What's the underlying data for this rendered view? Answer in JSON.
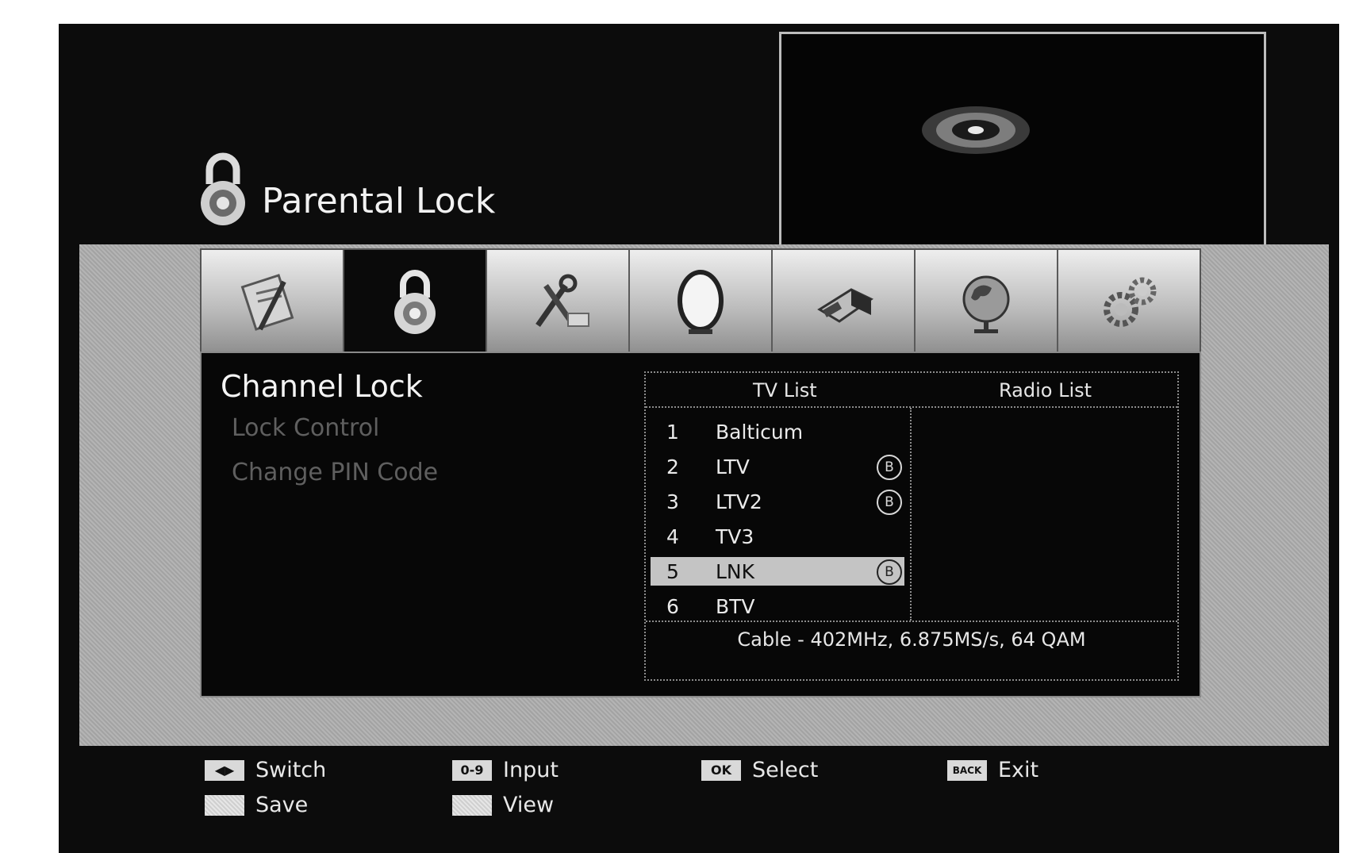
{
  "title": "Parental Lock",
  "tabs": [
    {
      "icon": "document-edit-icon",
      "active": false
    },
    {
      "icon": "padlock-icon",
      "active": true
    },
    {
      "icon": "tools-icon",
      "active": false
    },
    {
      "icon": "satellite-dish-icon",
      "active": false
    },
    {
      "icon": "usb-drive-icon",
      "active": false
    },
    {
      "icon": "globe-icon",
      "active": false
    },
    {
      "icon": "gears-icon",
      "active": false
    }
  ],
  "menu": {
    "section_title": "Channel Lock",
    "items": [
      "Lock Control",
      "Change PIN Code"
    ]
  },
  "channel_list": {
    "tv_header": "TV List",
    "radio_header": "Radio List",
    "rows": [
      {
        "num": "1",
        "name": "Balticum",
        "locked": false,
        "selected": false
      },
      {
        "num": "2",
        "name": "LTV",
        "locked": true,
        "selected": false
      },
      {
        "num": "3",
        "name": "LTV2",
        "locked": true,
        "selected": false
      },
      {
        "num": "4",
        "name": "TV3",
        "locked": false,
        "selected": false
      },
      {
        "num": "5",
        "name": "LNK",
        "locked": true,
        "selected": true
      },
      {
        "num": "6",
        "name": "BTV",
        "locked": false,
        "selected": false
      }
    ],
    "lock_symbol": "B",
    "frequency_info": "Cable - 402MHz, 6.875MS/s, 64 QAM"
  },
  "footer": {
    "switch": {
      "key": "◀▶",
      "label": "Switch"
    },
    "input": {
      "key": "0-9",
      "label": "Input"
    },
    "select": {
      "key": "OK",
      "label": "Select"
    },
    "exit": {
      "key": "BACK",
      "label": "Exit"
    },
    "save": {
      "label": "Save"
    },
    "view": {
      "label": "View"
    }
  }
}
